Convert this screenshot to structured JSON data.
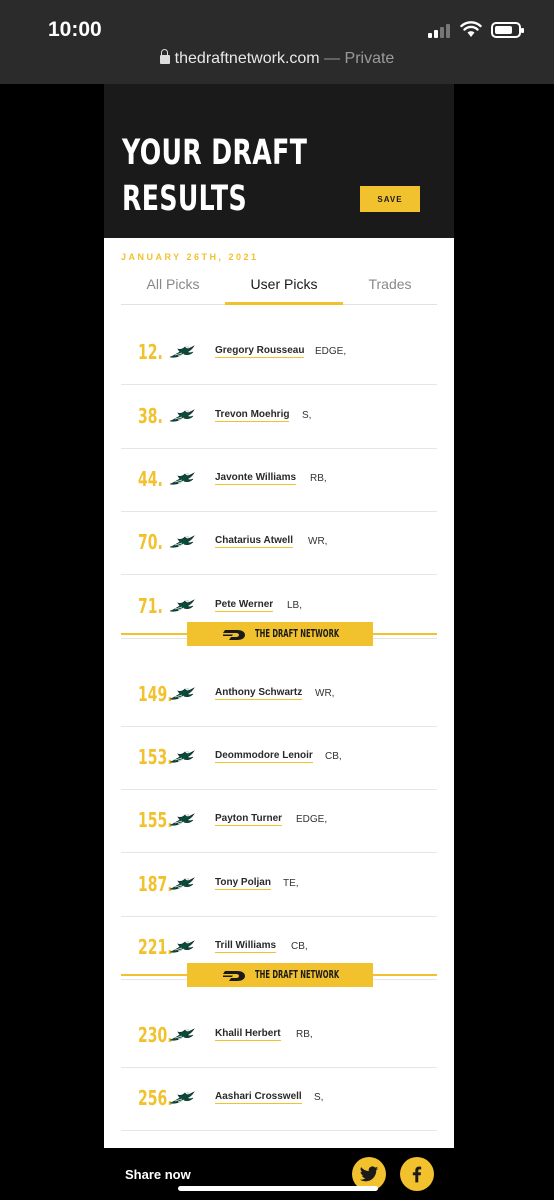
{
  "status_bar": {
    "time": "10:00"
  },
  "browser": {
    "domain": "thedraftnetwork.com",
    "suffix": "— Private"
  },
  "header": {
    "title_line1": "YOUR DRAFT",
    "title_line2": "RESULTS",
    "save_label": "SAVE"
  },
  "date": "JANUARY 26TH, 2021",
  "tabs": [
    {
      "label": "All Picks",
      "active": false
    },
    {
      "label": "User Picks",
      "active": true
    },
    {
      "label": "Trades",
      "active": false
    }
  ],
  "team_icon": "eagles-logo-icon",
  "picks": [
    {
      "number": "12.",
      "name": "Gregory Rousseau",
      "position": "EDGE,"
    },
    {
      "number": "38.",
      "name": "Trevon Moehrig",
      "position": "S,"
    },
    {
      "number": "44.",
      "name": "Javonte Williams",
      "position": "RB,"
    },
    {
      "number": "70.",
      "name": "Chatarius Atwell",
      "position": "WR,"
    },
    {
      "number": "71.",
      "name": "Pete Werner",
      "position": "LB,"
    },
    {
      "number": "149.",
      "name": "Anthony Schwartz",
      "position": "WR,"
    },
    {
      "number": "153.",
      "name": "Deommodore Lenoir",
      "position": "CB,"
    },
    {
      "number": "155.",
      "name": "Payton Turner",
      "position": "EDGE,"
    },
    {
      "number": "187.",
      "name": "Tony Poljan",
      "position": "TE,"
    },
    {
      "number": "221.",
      "name": "Trill Williams",
      "position": "CB,"
    },
    {
      "number": "230.",
      "name": "Khalil Herbert",
      "position": "RB,"
    },
    {
      "number": "256.",
      "name": "Aashari Crosswell",
      "position": "S,"
    }
  ],
  "divider_badge": "THE DRAFT NETWORK",
  "footer": {
    "share_label": "Share now"
  },
  "colors": {
    "accent": "#f2c12e",
    "dark": "#1a1a1a"
  }
}
